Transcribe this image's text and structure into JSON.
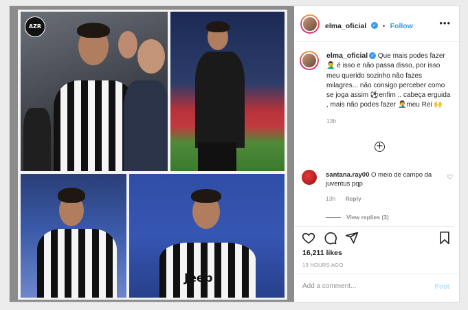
{
  "post": {
    "watermark": "AZR",
    "shirt_sponsor": "Jeep"
  },
  "header": {
    "username": "elma_oficial",
    "verified_icon": "verified-badge-icon",
    "separator": "•",
    "follow_label": "Follow",
    "more_label": "•••"
  },
  "caption": {
    "username": "elma_oficial",
    "text": "Que mais podes fazer 🤦‍♂️ é isso e não passa disso, por isso meu querido sozinho não fazes milagres... não consigo perceber como se joga assim ⚽enfim .. cabeça erguida , mais não podes fazer 🤦‍♂️meu Rei 🙌",
    "time": "13h"
  },
  "load_more": {
    "icon": "plus-circle-icon",
    "label": "+"
  },
  "comment": {
    "username": "santana.ray00",
    "text": "O meio de campo da juventus pqp",
    "time": "13h",
    "reply_label": "Reply",
    "heart_icon": "♡"
  },
  "view_replies": {
    "label": "View replies (3)"
  },
  "actions": {
    "icons": [
      "heart-icon",
      "comment-icon",
      "share-icon",
      "save-icon"
    ]
  },
  "likes": {
    "label": "16,211 likes"
  },
  "posted_ago": {
    "label": "13 HOURS AGO"
  },
  "add_comment": {
    "placeholder": "Add a comment...",
    "post_label": "Post"
  },
  "colors": {
    "accent": "#3897f0",
    "post_disabled": "#b2dffc",
    "muted": "#8e8e8e"
  }
}
